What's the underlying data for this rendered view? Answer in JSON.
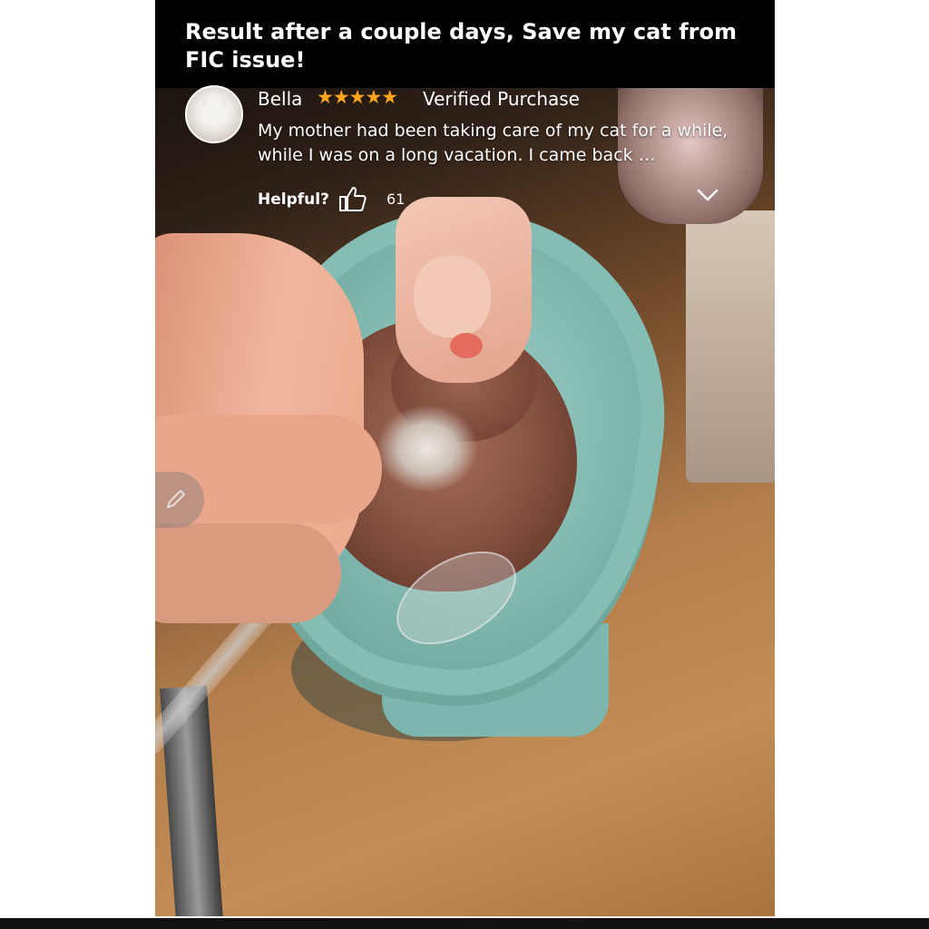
{
  "header": {
    "title": "Result after a couple days, Save my cat from FIC issue!"
  },
  "review": {
    "reviewer_name": "Bella",
    "rating": 5,
    "stars": "★★★★★",
    "badge": "Verified Purchase",
    "text": "My mother had been taking care of my cat for a while, while I was on a long vacation. I came back …",
    "helpful_label": "Helpful?",
    "helpful_count": "61"
  },
  "icons": {
    "helpful": "thumbs-up-icon",
    "expand": "chevron-down-icon",
    "edit": "pencil-icon",
    "avatar": "cat-avatar"
  },
  "colors": {
    "star": "#ffa41c",
    "overlay_text": "#ffffff",
    "title_bar": "#000000"
  }
}
